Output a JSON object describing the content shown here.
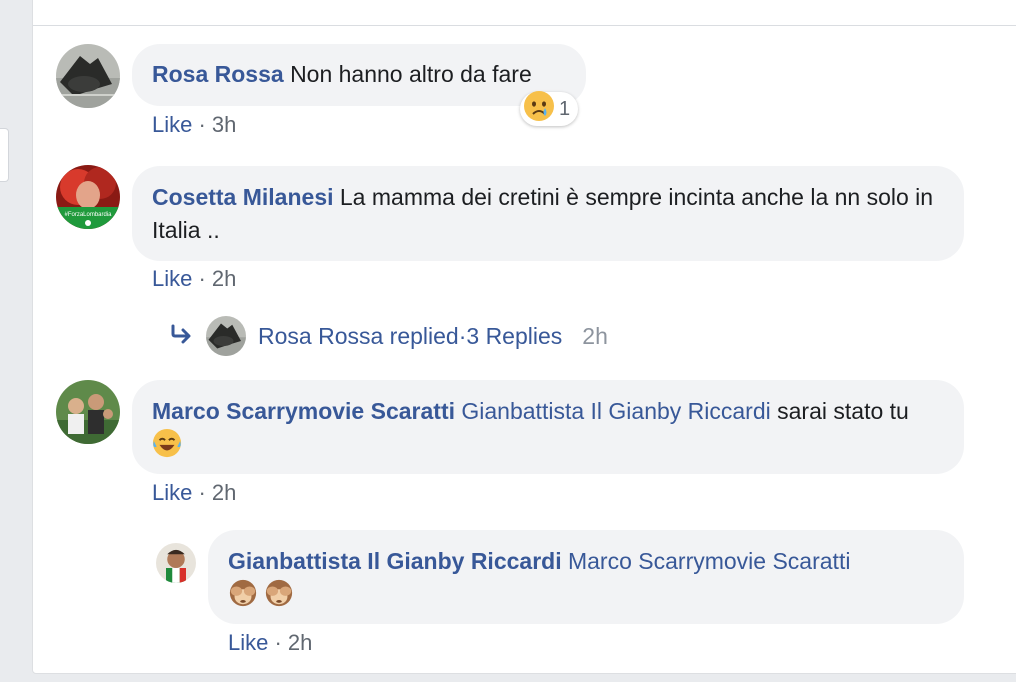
{
  "comments": [
    {
      "author": "Rosa Rossa",
      "text": "Non hanno altro da fare",
      "like_label": "Like",
      "separator": " · ",
      "time": "3h",
      "reaction": {
        "icon": "crying-face-emoji",
        "count": "1"
      }
    },
    {
      "author": "Cosetta Milanesi",
      "text": "La mamma dei cretini è sempre incinta anche la nn solo in Italia ..",
      "like_label": "Like",
      "separator": " · ",
      "time": "2h",
      "avatar_badge_text": "#ForzaLombardia",
      "replies": {
        "icon": "reply-arrow-icon",
        "text": "Rosa Rossa replied",
        "separator": " · ",
        "count_text": "3 Replies",
        "time": "2h"
      }
    },
    {
      "author": "Marco Scarrymovie Scaratti",
      "mention": "Gianbattista Il Gianby Riccardi",
      "text": "sarai stato tu",
      "emoji": "tears-of-joy-emoji",
      "like_label": "Like",
      "separator": " · ",
      "time": "2h"
    },
    {
      "author": "Gianbattista Il Gianby Riccardi",
      "mention": "Marco Scarrymovie Scaratti",
      "emoji": [
        "see-no-evil-monkey-emoji",
        "see-no-evil-monkey-emoji"
      ],
      "like_label": "Like",
      "separator": " · ",
      "time": "2h",
      "is_reply": true
    }
  ],
  "colors": {
    "link": "#385898",
    "meta": "#606770",
    "bubble": "#f2f3f5",
    "text": "#1c1e21"
  }
}
